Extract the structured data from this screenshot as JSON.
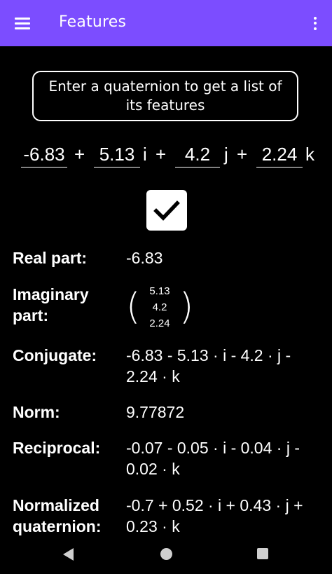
{
  "colors": {
    "app_bar": "#7c4dff",
    "background": "#000000",
    "text": "#ffffff",
    "nav_icons": "#cfcfcf"
  },
  "app_bar": {
    "title": "Features",
    "menu_icon": "hamburger-menu-icon",
    "overflow_icon": "more-vert-icon"
  },
  "hint": {
    "text": "Enter a quaternion to get a list of its features"
  },
  "quaternion": {
    "real": "-6.83",
    "i": "5.13",
    "j": "4.2",
    "k": "2.24",
    "plus_1": "+",
    "plus_2": "+",
    "plus_3": "+",
    "unit_i": "i",
    "unit_j": "j",
    "unit_k": "k"
  },
  "confirm_button": {
    "icon": "checkmark-icon"
  },
  "features": {
    "real_part": {
      "label": "Real part:",
      "value": "-6.83"
    },
    "imaginary_part": {
      "label": "Imaginary part:",
      "open_paren": "(",
      "close_paren": ")",
      "values": [
        "5.13",
        "4.2",
        "2.24"
      ]
    },
    "conjugate": {
      "label": "Conjugate:",
      "value": "-6.83 - 5.13 · i - 4.2 · j - 2.24 · k"
    },
    "norm": {
      "label": "Norm:",
      "value": "9.77872"
    },
    "reciprocal": {
      "label": "Reciprocal:",
      "value": "-0.07 - 0.05 · i - 0.04 · j - 0.02 · k"
    },
    "normalized": {
      "label": "Normalized quaternion:",
      "value": "-0.7 + 0.52 · i + 0.43 · j + 0.23 · k"
    }
  },
  "nav_bar": {
    "back_icon": "back-triangle-icon",
    "home_icon": "home-circle-icon",
    "recents_icon": "recents-square-icon"
  }
}
